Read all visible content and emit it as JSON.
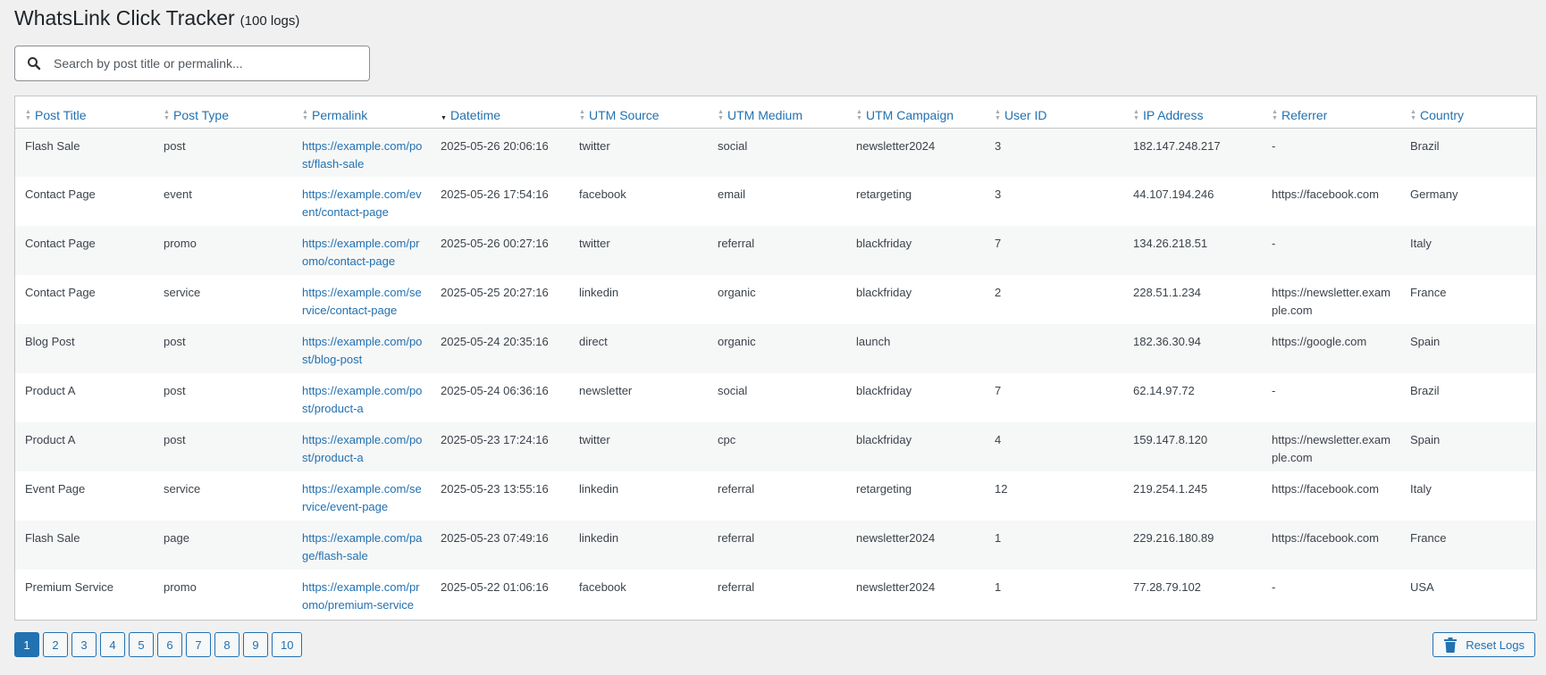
{
  "header": {
    "title": "WhatsLink Click Tracker",
    "count": "(100 logs)"
  },
  "search": {
    "placeholder": "Search by post title or permalink...",
    "value": ""
  },
  "table": {
    "columns": [
      {
        "label": "Post Title",
        "sorted": false
      },
      {
        "label": "Post Type",
        "sorted": false
      },
      {
        "label": "Permalink",
        "sorted": false
      },
      {
        "label": "Datetime",
        "sorted": true
      },
      {
        "label": "UTM Source",
        "sorted": false
      },
      {
        "label": "UTM Medium",
        "sorted": false
      },
      {
        "label": "UTM Campaign",
        "sorted": false
      },
      {
        "label": "User ID",
        "sorted": false
      },
      {
        "label": "IP Address",
        "sorted": false
      },
      {
        "label": "Referrer",
        "sorted": false
      },
      {
        "label": "Country",
        "sorted": false
      }
    ],
    "rows": [
      {
        "post_title": "Flash Sale",
        "post_type": "post",
        "permalink": "https://example.com/post/flash-sale",
        "datetime": "2025-05-26 20:06:16",
        "utm_source": "twitter",
        "utm_medium": "social",
        "utm_campaign": "newsletter2024",
        "user_id": "3",
        "ip": "182.147.248.217",
        "referrer": "-",
        "country": "Brazil"
      },
      {
        "post_title": "Contact Page",
        "post_type": "event",
        "permalink": "https://example.com/event/contact-page",
        "datetime": "2025-05-26 17:54:16",
        "utm_source": "facebook",
        "utm_medium": "email",
        "utm_campaign": "retargeting",
        "user_id": "3",
        "ip": "44.107.194.246",
        "referrer": "https://facebook.com",
        "country": "Germany"
      },
      {
        "post_title": "Contact Page",
        "post_type": "promo",
        "permalink": "https://example.com/promo/contact-page",
        "datetime": "2025-05-26 00:27:16",
        "utm_source": "twitter",
        "utm_medium": "referral",
        "utm_campaign": "blackfriday",
        "user_id": "7",
        "ip": "134.26.218.51",
        "referrer": "-",
        "country": "Italy"
      },
      {
        "post_title": "Contact Page",
        "post_type": "service",
        "permalink": "https://example.com/service/contact-page",
        "datetime": "2025-05-25 20:27:16",
        "utm_source": "linkedin",
        "utm_medium": "organic",
        "utm_campaign": "blackfriday",
        "user_id": "2",
        "ip": "228.51.1.234",
        "referrer": "https://newsletter.example.com",
        "country": "France"
      },
      {
        "post_title": "Blog Post",
        "post_type": "post",
        "permalink": "https://example.com/post/blog-post",
        "datetime": "2025-05-24 20:35:16",
        "utm_source": "direct",
        "utm_medium": "organic",
        "utm_campaign": "launch",
        "user_id": "",
        "ip": "182.36.30.94",
        "referrer": "https://google.com",
        "country": "Spain"
      },
      {
        "post_title": "Product A",
        "post_type": "post",
        "permalink": "https://example.com/post/product-a",
        "datetime": "2025-05-24 06:36:16",
        "utm_source": "newsletter",
        "utm_medium": "social",
        "utm_campaign": "blackfriday",
        "user_id": "7",
        "ip": "62.14.97.72",
        "referrer": "-",
        "country": "Brazil"
      },
      {
        "post_title": "Product A",
        "post_type": "post",
        "permalink": "https://example.com/post/product-a",
        "datetime": "2025-05-23 17:24:16",
        "utm_source": "twitter",
        "utm_medium": "cpc",
        "utm_campaign": "blackfriday",
        "user_id": "4",
        "ip": "159.147.8.120",
        "referrer": "https://newsletter.example.com",
        "country": "Spain"
      },
      {
        "post_title": "Event Page",
        "post_type": "service",
        "permalink": "https://example.com/service/event-page",
        "datetime": "2025-05-23 13:55:16",
        "utm_source": "linkedin",
        "utm_medium": "referral",
        "utm_campaign": "retargeting",
        "user_id": "12",
        "ip": "219.254.1.245",
        "referrer": "https://facebook.com",
        "country": "Italy"
      },
      {
        "post_title": "Flash Sale",
        "post_type": "page",
        "permalink": "https://example.com/page/flash-sale",
        "datetime": "2025-05-23 07:49:16",
        "utm_source": "linkedin",
        "utm_medium": "referral",
        "utm_campaign": "newsletter2024",
        "user_id": "1",
        "ip": "229.216.180.89",
        "referrer": "https://facebook.com",
        "country": "France"
      },
      {
        "post_title": "Premium Service",
        "post_type": "promo",
        "permalink": "https://example.com/promo/premium-service",
        "datetime": "2025-05-22 01:06:16",
        "utm_source": "facebook",
        "utm_medium": "referral",
        "utm_campaign": "newsletter2024",
        "user_id": "1",
        "ip": "77.28.79.102",
        "referrer": "-",
        "country": "USA"
      }
    ]
  },
  "pagination": {
    "pages": [
      "1",
      "2",
      "3",
      "4",
      "5",
      "6",
      "7",
      "8",
      "9",
      "10"
    ],
    "current": "1"
  },
  "reset": {
    "label": "Reset Logs",
    "icon": "trash-icon"
  },
  "colors": {
    "accent": "#2271b1",
    "background": "#f0f0f1",
    "text": "#3c434a",
    "row_alt": "#f6f7f7"
  }
}
